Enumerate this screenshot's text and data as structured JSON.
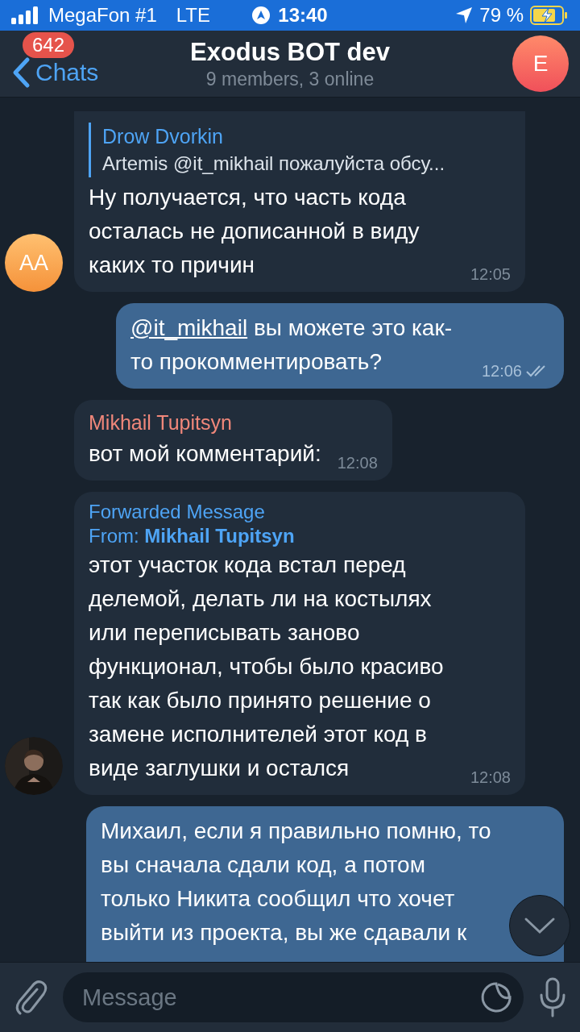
{
  "status_bar": {
    "carrier": "MegaFon #1",
    "network": "LTE",
    "time": "13:40",
    "battery": "79 %"
  },
  "header": {
    "back": "Chats",
    "badge": "642",
    "title": "Exodus BOT dev",
    "subtitle": "9 members, 3 online",
    "avatar_letter": "E"
  },
  "messages": [
    {
      "kind": "incoming",
      "reply": {
        "author": "Drow Dvorkin",
        "text": "Artemis @it_mikhail пожалуйста обсу..."
      },
      "text": "Ну получается, что часть кода осталась не дописанной в виду каких то причин",
      "time": "12:05",
      "avatar": {
        "kind": "initials",
        "text": "AA"
      }
    },
    {
      "kind": "outgoing",
      "mention": "@it_mikhail",
      "text": "вы можете это как-то прокомментировать?",
      "time": "12:06",
      "read": true
    },
    {
      "kind": "incoming",
      "sender": "Mikhail Tupitsyn",
      "text": "вот мой комментарий:",
      "time": "12:08"
    },
    {
      "kind": "incoming",
      "forwarded": {
        "label": "Forwarded Message",
        "from": "From: **Mikhail Tupitsyn**"
      },
      "text": "этот участок кода встал перед делемой, делать ли на костылях или переписывать заново функционал, чтобы было красиво\nтак как было принято решение о замене исполнителей этот код в виде заглушки и остался",
      "time": "12:08"
    },
    {
      "kind": "outgoing",
      "text": "Михаил, если я правильно помню, то вы сначала сдали код, а потом только Никита сообщил что хочет выйти из проекта, вы же сдавали к"
    }
  ],
  "composer": {
    "placeholder": "Message"
  }
}
